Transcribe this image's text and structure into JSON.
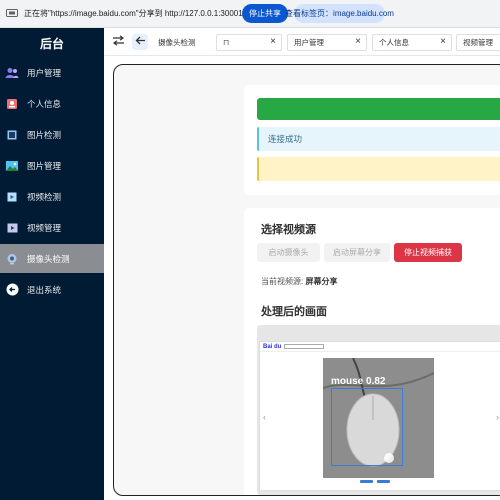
{
  "share_bar": {
    "text": "正在将\"https://image.baidu.com\"分享到 http://127.0.0.1:30001",
    "stop_label": "停止共享",
    "view_tab_label": "查看标签页：image.baidu.com",
    "accent": "#0b57d0"
  },
  "sidebar": {
    "title": "后台",
    "items": [
      {
        "label": "用户管理",
        "icon": "users-icon"
      },
      {
        "label": "个人信息",
        "icon": "id-card-icon"
      },
      {
        "label": "图片检测",
        "icon": "image-detect-icon"
      },
      {
        "label": "图片管理",
        "icon": "picture-icon"
      },
      {
        "label": "视频检测",
        "icon": "video-detect-icon"
      },
      {
        "label": "视频管理",
        "icon": "video-manage-icon"
      },
      {
        "label": "摄像头检测",
        "icon": "camera-icon",
        "active": true
      },
      {
        "label": "退出系统",
        "icon": "logout-icon"
      }
    ],
    "bg": "#001b33"
  },
  "tabbar": {
    "tabs": [
      {
        "label": "摄像头检测",
        "closable": false
      },
      {
        "label": "",
        "closable": true
      },
      {
        "label": "用户管理",
        "closable": true
      },
      {
        "label": "个人信息",
        "closable": true
      },
      {
        "label": "视频管理",
        "closable": false
      }
    ]
  },
  "content": {
    "status_success": "",
    "status_info": "连接成功",
    "status_warning": "",
    "select_title": "选择视频源",
    "buttons": {
      "start_camera": "启动摄像头",
      "start_screen": "启动屏幕分享",
      "stop_capture": "停止视频捕获"
    },
    "source_prefix": "当前视频源: ",
    "source_value": "屏幕分享",
    "processed_title": "处理后的画面",
    "detection": {
      "label": "mouse",
      "confidence": "0.82"
    },
    "preview_logo": "Bai du"
  },
  "colors": {
    "success": "#28a745",
    "info_bg": "#e6f4fb",
    "warning_bg": "#fff3c7",
    "danger": "#dc3545",
    "detection_box": "#3a7bd5"
  }
}
